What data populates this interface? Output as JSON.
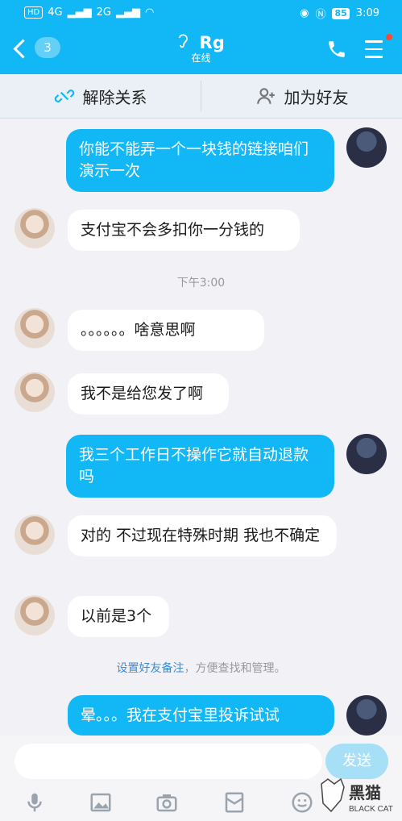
{
  "status": {
    "left_badges": [
      "HD",
      "4G",
      "2G"
    ],
    "battery": "85",
    "time": "3:09"
  },
  "header": {
    "back_count": "3",
    "name": "Rg",
    "presence": "在线"
  },
  "actions": {
    "remove_label": "解除关系",
    "add_friend_label": "加为好友"
  },
  "messages": [
    {
      "from": "me",
      "text": "你能不能弄一个一块钱的链接咱们演示一次"
    },
    {
      "from": "her",
      "text": "支付宝不会多扣你一分钱的"
    },
    {
      "from": "her",
      "text": "。。。。。。啥意思啊"
    },
    {
      "from": "her",
      "text": "我不是给您发了啊"
    },
    {
      "from": "me",
      "text": "我三个工作日不操作它就自动退款吗"
    },
    {
      "from": "her",
      "text": "对的   不过现在特殊时期 我也不确定"
    },
    {
      "from": "her",
      "text": "以前是3个"
    },
    {
      "from": "me",
      "text": "晕。。。我在支付宝里投诉试试"
    }
  ],
  "timestamp": "下午3:00",
  "hint": {
    "link": "设置好友备注",
    "rest": "，方便查找和管理。"
  },
  "composer": {
    "placeholder": "",
    "send_label": "发送"
  },
  "watermark": {
    "brand_cn": "黑猫",
    "brand_en": "BLACK CAT"
  },
  "colors": {
    "accent": "#12b7f5",
    "send_disabled": "#a7dff7",
    "link": "#3b8cd8"
  }
}
